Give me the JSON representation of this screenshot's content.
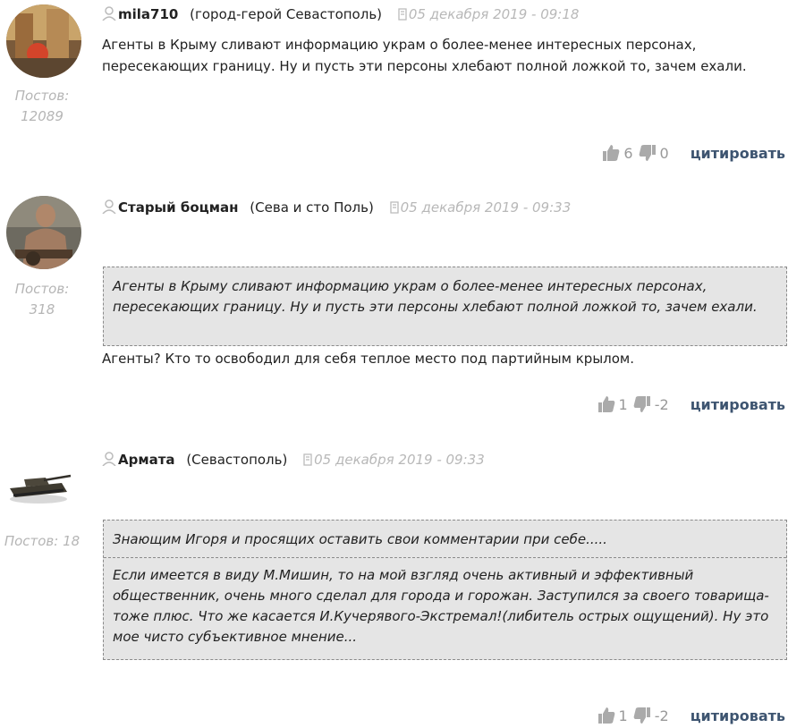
{
  "comments": [
    {
      "author": "mila710",
      "location": "(город-герой Севастополь)",
      "date": "05 декабря 2019 - 09:18",
      "posts_label": "Постов:",
      "posts_count": "12089",
      "text": "Агенты в Крыму сливают информацию украм о более-менее интересных персонах, пересекающих границу. Ну и пусть эти персоны хлебают полной ложкой то, зачем ехали.",
      "likes": "6",
      "dislikes": "0",
      "quote_label": "цитировать"
    },
    {
      "author": "Старый боцман",
      "location": "(Сева и сто Поль)",
      "date": "05 декабря 2019 - 09:33",
      "posts_label": "Постов:",
      "posts_count": "318",
      "quote": "Агенты в Крыму сливают информацию украм о более-менее интересных персонах, пересекающих границу. Ну и пусть эти персоны хлебают полной ложкой то, зачем ехали.",
      "text": "Агенты?  Кто то освободил для себя теплое место под партийным крылом.",
      "likes": "1",
      "dislikes": "-2",
      "quote_label": "цитировать"
    },
    {
      "author": "Армата",
      "location": "(Севастополь)",
      "date": "05 декабря 2019 - 09:33",
      "posts_label": "Постов: 18",
      "quote_top": "Знающим Игоря и просящих оставить свои комментарии при себе.....",
      "quote_bottom": "Если имеется в виду М.Мишин, то на мой взгляд очень активный и эффективный общественник, очень много сделал для города и горожан. Заступился за своего товарища-тоже плюс. Что же касается И.Кучерявого-Экстремал!(либитель острых ощущений). Ну это мое чисто субъективное мнение...",
      "likes": "1",
      "dislikes": "-2",
      "quote_label": "цитировать"
    }
  ]
}
